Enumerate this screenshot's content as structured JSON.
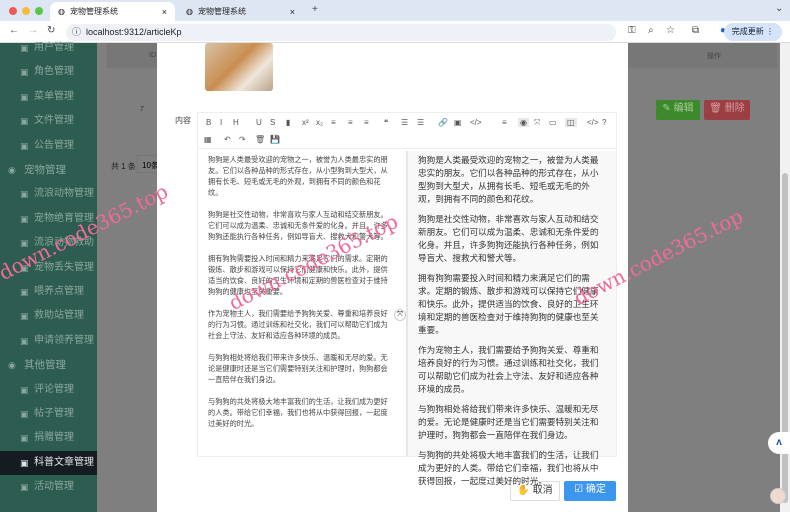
{
  "browser": {
    "tabs": [
      {
        "title": "宠物管理系统",
        "close": "×"
      },
      {
        "title": "宠物管理系统",
        "close": "×"
      }
    ],
    "new_tab": "+",
    "url": "localhost:9312/articleKp",
    "update_button": "完成更新"
  },
  "sidebar": {
    "items": [
      {
        "label": "用户管理",
        "icon": "user-icon"
      },
      {
        "label": "角色管理",
        "icon": "role-icon"
      },
      {
        "label": "菜单管理",
        "icon": "gear-icon"
      },
      {
        "label": "文件管理",
        "icon": "file-icon"
      },
      {
        "label": "公告管理",
        "icon": "notice-icon"
      },
      {
        "label": "宠物管理",
        "icon": "pet-icon",
        "group": true
      },
      {
        "label": "流浪动物管理",
        "icon": "animal-icon"
      },
      {
        "label": "宠物绝育管理",
        "icon": "sterilize-icon"
      },
      {
        "label": "流浪动物救助",
        "icon": "rescue-icon"
      },
      {
        "label": "宠物丢失管理",
        "icon": "lost-icon"
      },
      {
        "label": "喂养点管理",
        "icon": "feed-icon"
      },
      {
        "label": "救助站管理",
        "icon": "station-icon"
      },
      {
        "label": "申请领养管理",
        "icon": "adopt-icon"
      },
      {
        "label": "其他管理",
        "icon": "list-icon",
        "group": true
      },
      {
        "label": "评论管理",
        "icon": "comment-icon"
      },
      {
        "label": "帖子管理",
        "icon": "post-icon"
      },
      {
        "label": "捐赠管理",
        "icon": "donate-icon"
      },
      {
        "label": "科普文章管理",
        "icon": "article-icon",
        "active": true
      },
      {
        "label": "活动管理",
        "icon": "activity-icon"
      }
    ]
  },
  "table": {
    "col_id": "ID ⇕",
    "col_action": "操作",
    "row_id": "7",
    "edit": "编辑",
    "delete": "删除",
    "total": "共 1 条",
    "page_size": "10条/页"
  },
  "dialog": {
    "content_label": "内容",
    "cancel": "取消",
    "confirm": "确定"
  },
  "editor": {
    "toolbar": [
      "B",
      "I",
      "H",
      "U",
      "S",
      "▮",
      "x²",
      "x₂",
      "≡",
      "≡",
      "≡",
      "❝",
      "☰",
      "☰",
      "🔗",
      "▣",
      "</>",
      "≡",
      "◉",
      "⤧",
      "▭",
      "◫",
      "</>",
      "?",
      "▦",
      "↶",
      "↷",
      "🗑",
      "💾"
    ],
    "paragraphs": [
      "狗狗是人类最受欢迎的宠物之一，被誉为人类最忠实的朋友。它们以各种品种的形式存在，从小型狗到大型犬，从拥有长毛、短毛或无毛的外观，到拥有不同的颜色和花纹。",
      "狗狗是社交性动物，非常喜欢与家人互动和结交新朋友。它们可以成为温柔、忠诚和无条件爱的化身。并且，许多狗狗还能执行各种任务，例如导盲犬、搜救犬和警犬等。",
      "拥有狗狗需要投入时间和精力来满足它们的需求。定期的锻炼、散步和游戏可以保持它们健康和快乐。此外，提供适当的饮食、良好的卫生环境和定期的兽医检查对于维持狗狗的健康也至关重要。",
      "作为宠物主人，我们需要给予狗狗关爱、尊重和培养良好的行为习惯。通过训练和社交化，我们可以帮助它们成为社会上守法、友好和适应各种环境的成员。",
      "与狗狗相处将给我们带来许多快乐、温暖和无尽的爱。无论是健康时还是当它们需要特别关注和护理时，狗狗都会一直陪伴在我们身边。",
      "与狗狗的共处将极大地丰富我们的生活，让我们成为更好的人类。带给它们幸福，我们也将从中获得回报，一起度过美好的时光。"
    ]
  },
  "watermarks": [
    "down.code365.top",
    "down.code365.top",
    "down.code365.top"
  ]
}
